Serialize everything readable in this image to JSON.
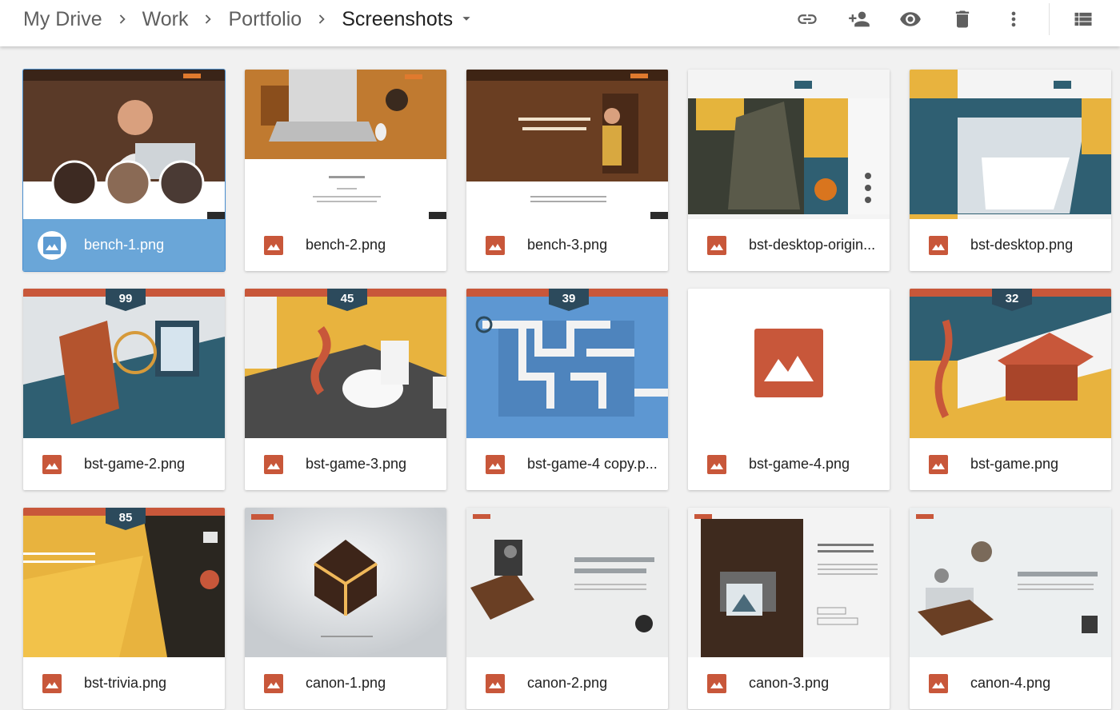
{
  "breadcrumb": {
    "items": [
      "My Drive",
      "Work",
      "Portfolio"
    ],
    "current": "Screenshots"
  },
  "toolbar": [
    "link-icon",
    "add-person-icon",
    "eye-icon",
    "trash-icon",
    "more-vert-icon",
    "list-view-icon"
  ],
  "colors": {
    "file_icon": "#c8573a",
    "selected": "#6aa6d8"
  },
  "files": [
    {
      "name": "bench-1.png",
      "selected": true
    },
    {
      "name": "bench-2.png"
    },
    {
      "name": "bench-3.png"
    },
    {
      "name": "bst-desktop-origin..."
    },
    {
      "name": "bst-desktop.png"
    },
    {
      "name": "bst-game-2.png",
      "badge": "99"
    },
    {
      "name": "bst-game-3.png",
      "badge": "45"
    },
    {
      "name": "bst-game-4 copy.p...",
      "badge": "39"
    },
    {
      "name": "bst-game-4.png"
    },
    {
      "name": "bst-game.png",
      "badge": "32"
    },
    {
      "name": "bst-trivia.png",
      "badge": "85"
    },
    {
      "name": "canon-1.png"
    },
    {
      "name": "canon-2.png"
    },
    {
      "name": "canon-3.png"
    },
    {
      "name": "canon-4.png"
    }
  ]
}
